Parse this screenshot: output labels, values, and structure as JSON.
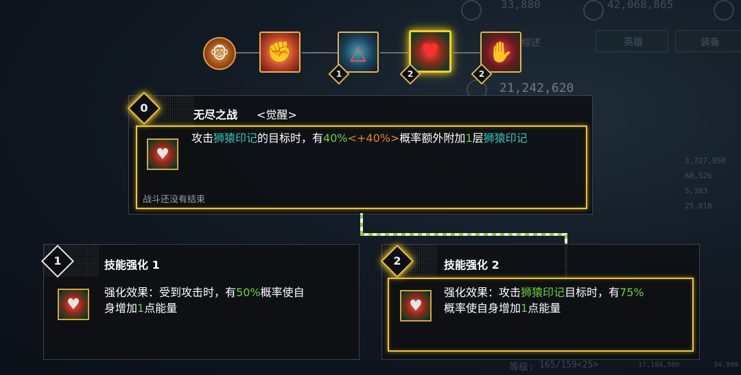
{
  "hud": {
    "top_value_1": "33,880",
    "top_value_2": "42,068,865",
    "mid_value": "21,242,620",
    "tab_left": "英雄",
    "tab_right": "装备",
    "label_small": "综述",
    "side_values": [
      "3,727,950",
      "68,526",
      "5,303",
      "25,818"
    ],
    "bottom_value_1": "17,184,500",
    "bottom_value_2": "34,999",
    "level_label": "等级:",
    "level_value": "165/159<25>"
  },
  "skill_row": {
    "skills": [
      {
        "name": "lion-ape-skill",
        "icon": "🐵",
        "badge": ""
      },
      {
        "name": "fist-skill",
        "icon": "✊",
        "badge": ""
      },
      {
        "name": "triangle-skill",
        "icon": "△",
        "badge": "1"
      },
      {
        "name": "mark-skill",
        "icon": "♥",
        "badge": "2"
      },
      {
        "name": "claw-skill",
        "icon": "✋",
        "badge": "2"
      }
    ]
  },
  "main_panel": {
    "level": "0",
    "title": "无尽之战",
    "tag": "<觉醒>",
    "desc_parts": {
      "p1": "攻击",
      "mark1": "狮猿印记",
      "p2": "的目标时，有",
      "pct": "40%",
      "bonus": "<+40%>",
      "p3": "概率额外附加",
      "stack": "1",
      "p4": "层",
      "mark2": "狮猿印记"
    },
    "note": "战斗还没有结束"
  },
  "panel_left": {
    "level": "1",
    "title": "技能强化 1",
    "desc_parts": {
      "p1": "强化效果：受到攻击时，有",
      "pct": "50%",
      "p2": "概率使自",
      "p3": "身增加",
      "num": "1",
      "p4": "点能量"
    }
  },
  "panel_right": {
    "level": "2",
    "title": "技能强化 2",
    "desc_parts": {
      "p1": "强化效果：攻击",
      "mark": "狮猿印记",
      "p2": "目标时，有",
      "pct": "75%",
      "p3": "概率使自身增加",
      "num": "1",
      "p4": "点能量"
    }
  },
  "colors": {
    "gold": "#f0c830",
    "teal": "#33c7c0",
    "green": "#6bd23a",
    "orange": "#e0872a"
  }
}
